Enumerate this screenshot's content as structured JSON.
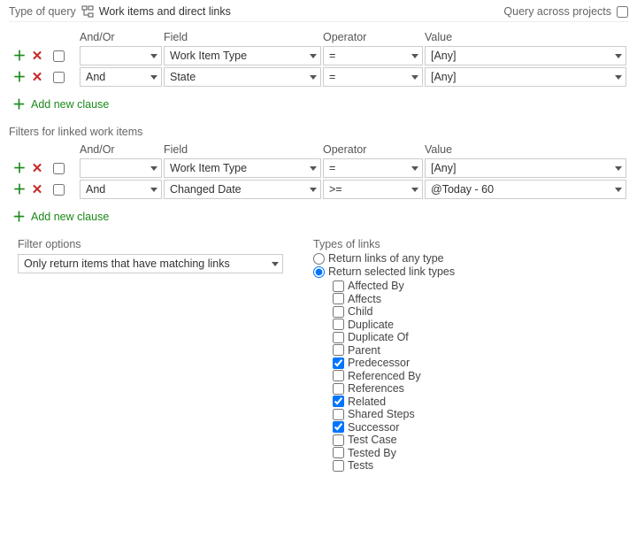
{
  "topbar": {
    "type_label": "Type of query",
    "query_type": "Work items and direct links",
    "cross_projects_label": "Query across projects",
    "cross_projects_checked": false
  },
  "headers": {
    "andor": "And/Or",
    "field": "Field",
    "operator": "Operator",
    "value": "Value"
  },
  "top_clauses": [
    {
      "checked": false,
      "andor": "",
      "field": "Work Item Type",
      "op": "=",
      "value": "[Any]"
    },
    {
      "checked": false,
      "andor": "And",
      "field": "State",
      "op": "=",
      "value": "[Any]"
    }
  ],
  "add_clause_label": "Add new clause",
  "linked_section_title": "Filters for linked work items",
  "linked_clauses": [
    {
      "checked": false,
      "andor": "",
      "field": "Work Item Type",
      "op": "=",
      "value": "[Any]"
    },
    {
      "checked": false,
      "andor": "And",
      "field": "Changed Date",
      "op": ">=",
      "value": "@Today - 60"
    }
  ],
  "filter_options": {
    "label": "Filter options",
    "selected": "Only return items that have matching links"
  },
  "link_types": {
    "label": "Types of links",
    "radio": {
      "any": "Return links of any type",
      "selected": "Return selected link types",
      "value": "selected"
    },
    "items": [
      {
        "name": "Affected By",
        "checked": false
      },
      {
        "name": "Affects",
        "checked": false
      },
      {
        "name": "Child",
        "checked": false
      },
      {
        "name": "Duplicate",
        "checked": false
      },
      {
        "name": "Duplicate Of",
        "checked": false
      },
      {
        "name": "Parent",
        "checked": false
      },
      {
        "name": "Predecessor",
        "checked": true
      },
      {
        "name": "Referenced By",
        "checked": false
      },
      {
        "name": "References",
        "checked": false
      },
      {
        "name": "Related",
        "checked": true
      },
      {
        "name": "Shared Steps",
        "checked": false
      },
      {
        "name": "Successor",
        "checked": true
      },
      {
        "name": "Test Case",
        "checked": false
      },
      {
        "name": "Tested By",
        "checked": false
      },
      {
        "name": "Tests",
        "checked": false
      }
    ]
  }
}
